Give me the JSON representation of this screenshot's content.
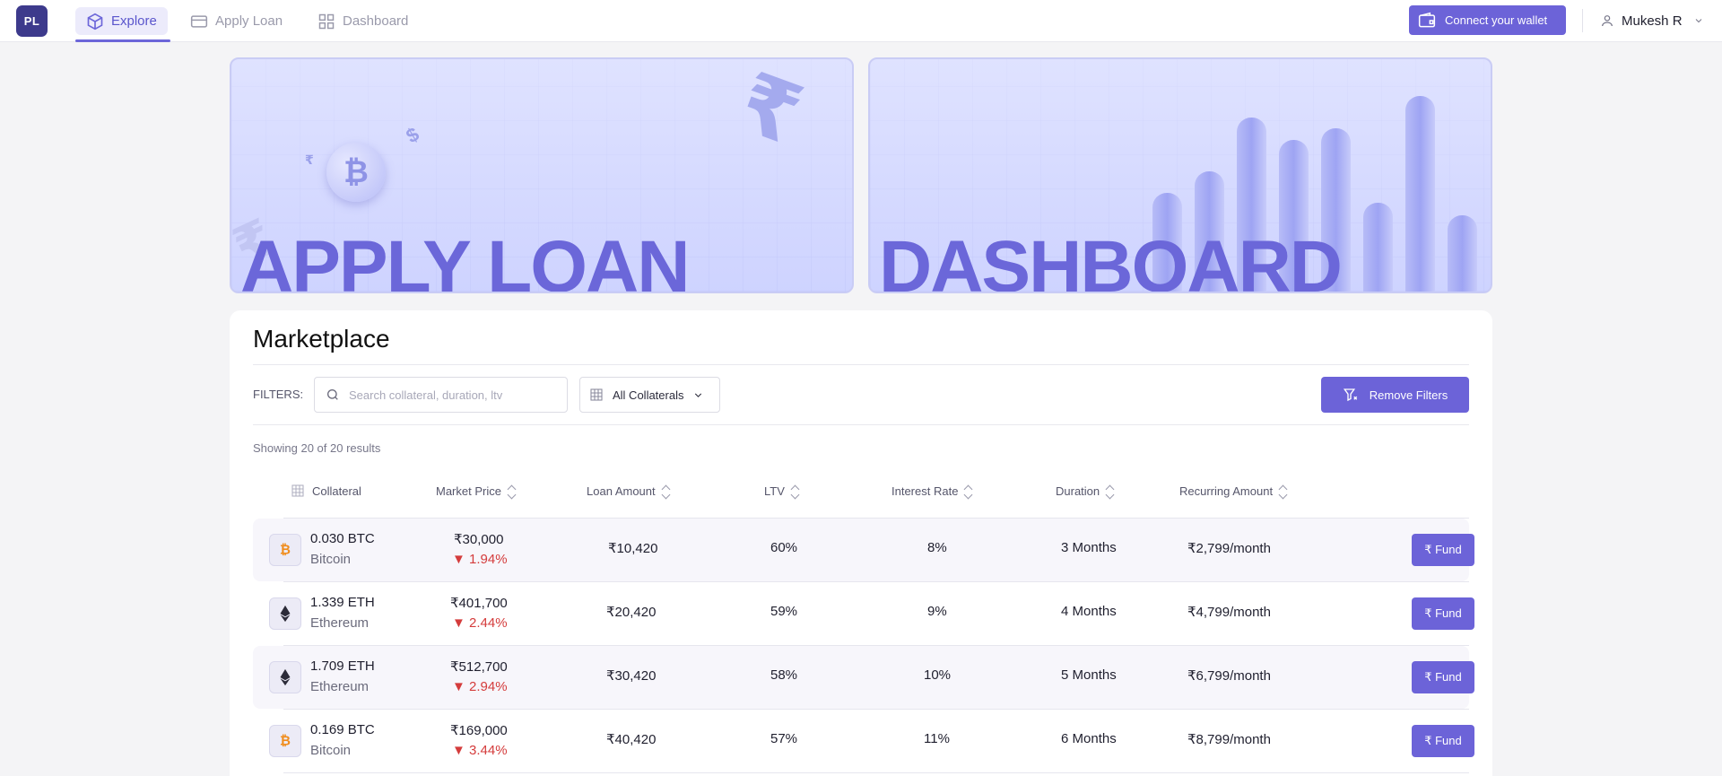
{
  "nav": {
    "logo": "PL",
    "tabs": [
      {
        "label": "Explore",
        "icon": "cube-icon",
        "active": true
      },
      {
        "label": "Apply Loan",
        "icon": "card-icon",
        "active": false
      },
      {
        "label": "Dashboard",
        "icon": "grid-icon",
        "active": false
      }
    ],
    "wallet_button": "Connect your wallet",
    "user_name": "Mukesh R"
  },
  "banners": {
    "apply_loan": "APPLY LOAN",
    "dashboard": "DASHBOARD"
  },
  "marketplace": {
    "title": "Marketplace",
    "filters_label": "FILTERS:",
    "search_placeholder": "Search collateral, duration, ltv",
    "collateral_select": "All Collaterals",
    "remove_filters": "Remove Filters",
    "showing": "Showing 20 of 20 results",
    "columns": [
      "Collateral",
      "Market Price",
      "Loan Amount",
      "LTV",
      "Interest Rate",
      "Duration",
      "Recurring Amount"
    ],
    "fund_label": "₹ Fund",
    "rows": [
      {
        "amount": "0.030 BTC",
        "asset": "Bitcoin",
        "coin": "btc",
        "price": "₹30,000",
        "change": "▼ 1.94%",
        "loan": "₹10,420",
        "ltv": "60%",
        "rate": "8%",
        "duration": "3 Months",
        "recurring": "₹2,799/month"
      },
      {
        "amount": "1.339 ETH",
        "asset": "Ethereum",
        "coin": "eth",
        "price": "₹401,700",
        "change": "▼ 2.44%",
        "loan": "₹20,420",
        "ltv": "59%",
        "rate": "9%",
        "duration": "4 Months",
        "recurring": "₹4,799/month"
      },
      {
        "amount": "1.709 ETH",
        "asset": "Ethereum",
        "coin": "eth",
        "price": "₹512,700",
        "change": "▼ 2.94%",
        "loan": "₹30,420",
        "ltv": "58%",
        "rate": "10%",
        "duration": "5 Months",
        "recurring": "₹6,799/month"
      },
      {
        "amount": "0.169 BTC",
        "asset": "Bitcoin",
        "coin": "btc",
        "price": "₹169,000",
        "change": "▼ 3.44%",
        "loan": "₹40,420",
        "ltv": "57%",
        "rate": "11%",
        "duration": "6 Months",
        "recurring": "₹8,799/month"
      }
    ]
  },
  "colors": {
    "accent": "#6c63d8",
    "negative": "#d43c3c",
    "banner_text": "#6b67d9"
  }
}
